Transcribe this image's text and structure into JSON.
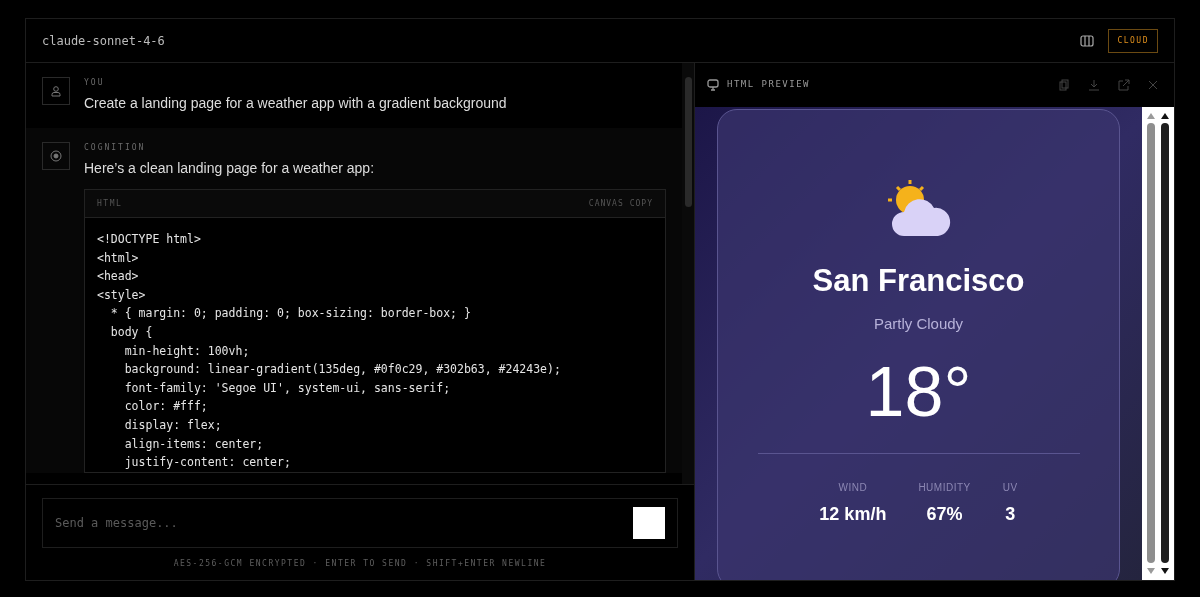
{
  "header": {
    "model": "claude-sonnet-4-6",
    "badge": "CLOUD"
  },
  "messages": [
    {
      "kind": "user",
      "role": "YOU",
      "text": "Create a landing page for a weather app with a gradient background"
    },
    {
      "kind": "assistant",
      "role": "COGNITION",
      "text": "Here’s a clean landing page for a weather app:",
      "code": {
        "language": "HTML",
        "actions": [
          "CANVAS",
          "COPY"
        ],
        "lines": [
          "<!DOCTYPE html>",
          "<html>",
          "<head>",
          "<style>",
          "  * { margin: 0; padding: 0; box-sizing: border-box; }",
          "  body {",
          "    min-height: 100vh;",
          "    background: linear-gradient(135deg, #0f0c29, #302b63, #24243e);",
          "    font-family: 'Segoe UI', system-ui, sans-serif;",
          "    color: #fff;",
          "    display: flex;",
          "    align-items: center;",
          "    justify-content: center;"
        ]
      }
    }
  ],
  "composer": {
    "placeholder": "Send a message...",
    "hint": "AES-256-GCM ENCRYPTED · ENTER TO SEND · SHIFT+ENTER NEWLINE"
  },
  "preview": {
    "title": "HTML PREVIEW",
    "city": "San Francisco",
    "condition": "Partly Cloudy",
    "temperature": "18°",
    "stats": [
      {
        "label": "WIND",
        "value": "12 km/h"
      },
      {
        "label": "HUMIDITY",
        "value": "67%"
      },
      {
        "label": "UV",
        "value": "3"
      }
    ]
  }
}
